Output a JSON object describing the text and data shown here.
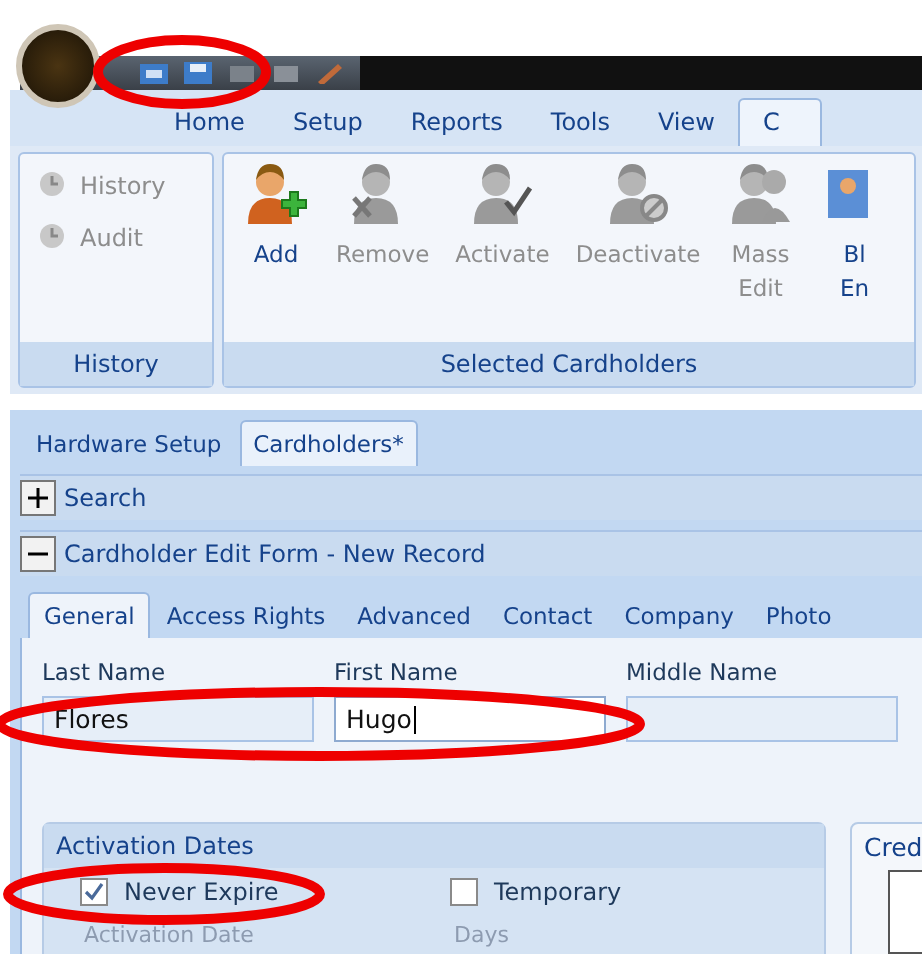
{
  "ribbon_tabs": [
    {
      "label": "Home",
      "selected": false
    },
    {
      "label": "Setup",
      "selected": false
    },
    {
      "label": "Reports",
      "selected": false
    },
    {
      "label": "Tools",
      "selected": false
    },
    {
      "label": "View",
      "selected": false
    },
    {
      "label": "C",
      "selected": true
    }
  ],
  "ribbon_groups": [
    {
      "title": "History",
      "kind": "small",
      "buttons": [
        {
          "label": "History",
          "disabled": true
        },
        {
          "label": "Audit",
          "disabled": true
        }
      ]
    },
    {
      "title": "Selected Cardholders",
      "kind": "large",
      "buttons": [
        {
          "label": "Add",
          "disabled": false
        },
        {
          "label": "Remove",
          "disabled": true
        },
        {
          "label": "Activate",
          "disabled": true
        },
        {
          "label": "Deactivate",
          "disabled": true
        },
        {
          "label": "Mass Edit",
          "disabled": true
        },
        {
          "label": "Bl En",
          "disabled": false
        }
      ]
    }
  ],
  "document_tabs": [
    {
      "label": "Hardware Setup",
      "selected": false
    },
    {
      "label": "Cardholders*",
      "selected": true
    }
  ],
  "panels": [
    {
      "title": "Search",
      "expanded": false
    },
    {
      "title": "Cardholder Edit Form - New Record",
      "expanded": true
    }
  ],
  "form_tabs": [
    {
      "label": "General",
      "selected": true
    },
    {
      "label": "Access Rights",
      "selected": false
    },
    {
      "label": "Advanced",
      "selected": false
    },
    {
      "label": "Contact",
      "selected": false
    },
    {
      "label": "Company",
      "selected": false
    },
    {
      "label": "Photo",
      "selected": false
    }
  ],
  "fields": [
    {
      "label": "Last Name",
      "value": "Flores",
      "focused": false
    },
    {
      "label": "First Name",
      "value": "Hugo",
      "focused": true
    },
    {
      "label": "Middle Name",
      "focused": false
    }
  ],
  "activation_dates": {
    "title": "Activation Dates",
    "options": [
      {
        "label": "Never Expire",
        "checked": true
      },
      {
        "label": "Temporary",
        "checked": false
      }
    ],
    "sublabels": [
      "Activation Date",
      "Days"
    ]
  },
  "side_panel": {
    "title": "Cred"
  }
}
